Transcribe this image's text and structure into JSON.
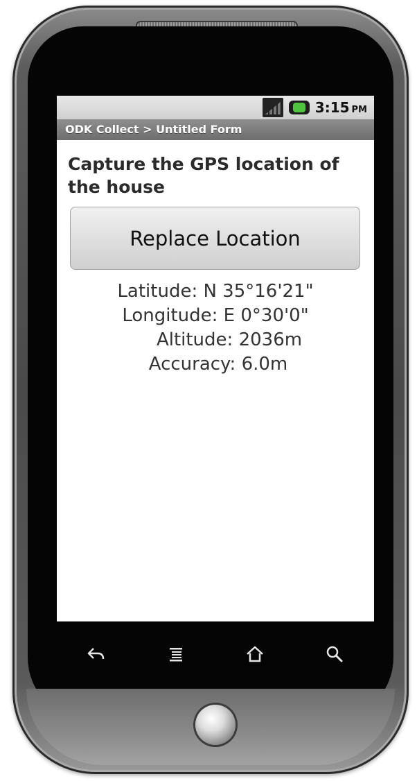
{
  "status_bar": {
    "time": "3:15",
    "ampm": "PM",
    "icons": [
      "signal-off-icon",
      "battery-charging-icon"
    ]
  },
  "app_title": "ODK Collect > Untitled Form",
  "question": "Capture the GPS location of the house",
  "button_label": "Replace Location",
  "location": {
    "latitude": "Latitude: N 35°16'21\"",
    "longitude": "Longitude: E 0°30'0\"",
    "altitude": "Altitude: 2036m",
    "accuracy": "Accuracy: 6.0m"
  },
  "nav_keys": [
    "back-icon",
    "menu-icon",
    "home-icon",
    "search-icon"
  ],
  "colors": {
    "battery_fill": "#4fc53f",
    "titlebar": "#7a7a7a",
    "screen_bg": "#ffffff",
    "phone_body": "#4a4a4a"
  }
}
